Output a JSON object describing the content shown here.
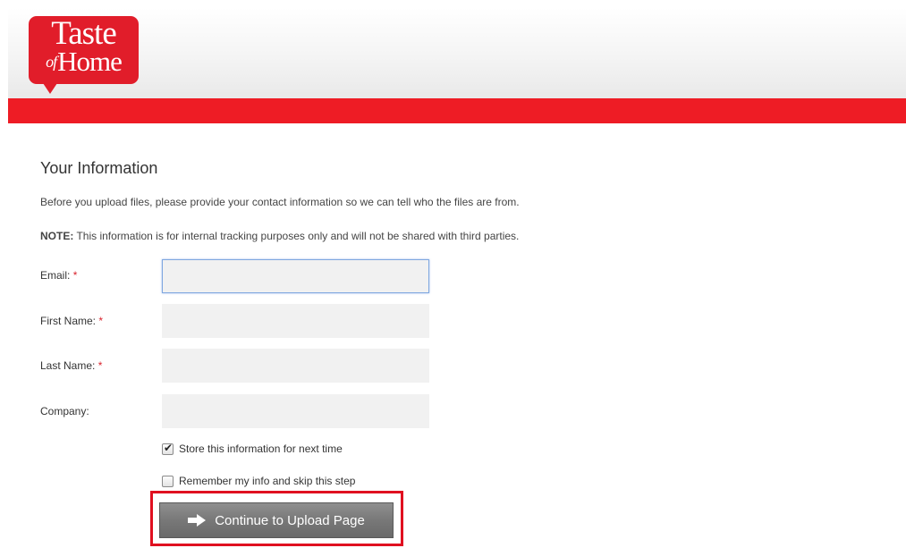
{
  "header": {
    "logo": {
      "line1": "Taste",
      "line2_of": "of",
      "line2_home": "Home"
    },
    "brand_colors": {
      "red": "#ee1c25",
      "logo_red": "#e11d2a"
    }
  },
  "form": {
    "title": "Your Information",
    "intro": "Before you upload files, please provide your contact information so we can tell who the files are from.",
    "note_label": "NOTE:",
    "note_text": " This information is for internal tracking purposes only and will not be shared with third parties.",
    "required_marker": "*",
    "fields": [
      {
        "label": "Email:",
        "required": true,
        "value": ""
      },
      {
        "label": "First Name:",
        "required": true,
        "value": ""
      },
      {
        "label": "Last Name:",
        "required": true,
        "value": ""
      },
      {
        "label": "Company:",
        "required": false,
        "value": ""
      }
    ],
    "checkboxes": [
      {
        "label": "Store this information for next time",
        "checked": true
      },
      {
        "label": "Remember my info and skip this step",
        "checked": false
      }
    ],
    "submit": {
      "icon": "arrow-right-icon",
      "label": "Continue to Upload Page"
    }
  }
}
